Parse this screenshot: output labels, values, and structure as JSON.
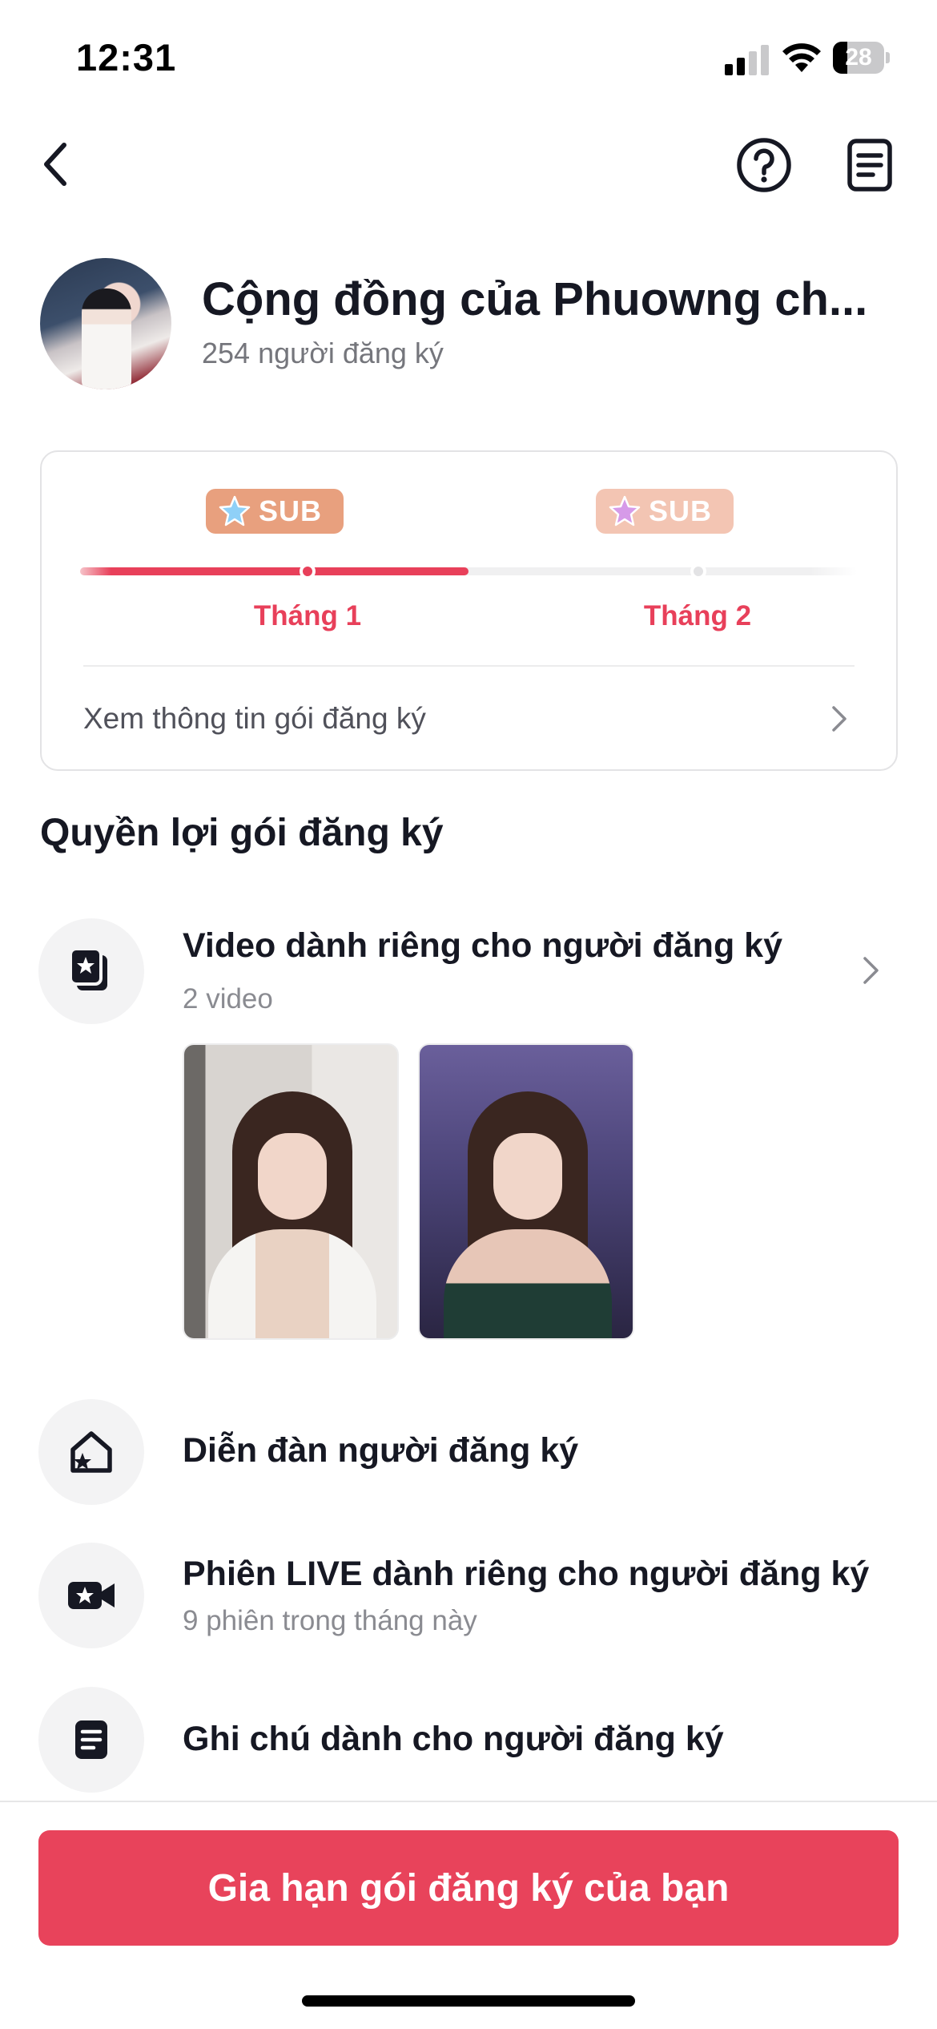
{
  "status_bar": {
    "time": "12:31",
    "battery_level": "28",
    "battery_fraction": 0.28,
    "icons": [
      "signal-icon",
      "wifi-icon",
      "battery-icon"
    ]
  },
  "nav": {
    "icons": [
      "back-chevron-icon",
      "help-icon",
      "notes-icon"
    ]
  },
  "header": {
    "title": "Cộng đồng của Phuowng ch...",
    "subscriber_count": "254 người đăng ký"
  },
  "subscription": {
    "badges": [
      {
        "label": "SUB",
        "color": "#e8a07e",
        "star_color": "#6fb7f2"
      },
      {
        "label": "SUB",
        "color": "#f3c5b3",
        "star_color": "#c27ddc"
      }
    ],
    "months": [
      "Tháng 1",
      "Tháng 2"
    ],
    "progress_fraction": 0.5,
    "view_info_label": "Xem thông tin gói đăng ký"
  },
  "benefits": {
    "section_title": "Quyền lợi gói đăng ký",
    "items": [
      {
        "title": "Video dành riêng cho người đăng ký",
        "subtitle": "2 video",
        "icon": "exclusive-video-icon"
      },
      {
        "title": "Diễn đàn người đăng ký",
        "subtitle": "",
        "icon": "forum-icon"
      },
      {
        "title": "Phiên LIVE dành riêng cho người đăng ký",
        "subtitle": "9 phiên trong tháng này",
        "icon": "live-camera-icon"
      },
      {
        "title": "Ghi chú dành cho người đăng ký",
        "subtitle": "",
        "icon": "note-icon"
      }
    ]
  },
  "cta": {
    "label": "Gia hạn gói đăng ký của bạn"
  },
  "colors": {
    "accent": "#e8435b",
    "text_primary": "#161823",
    "text_secondary": "#75767c"
  }
}
